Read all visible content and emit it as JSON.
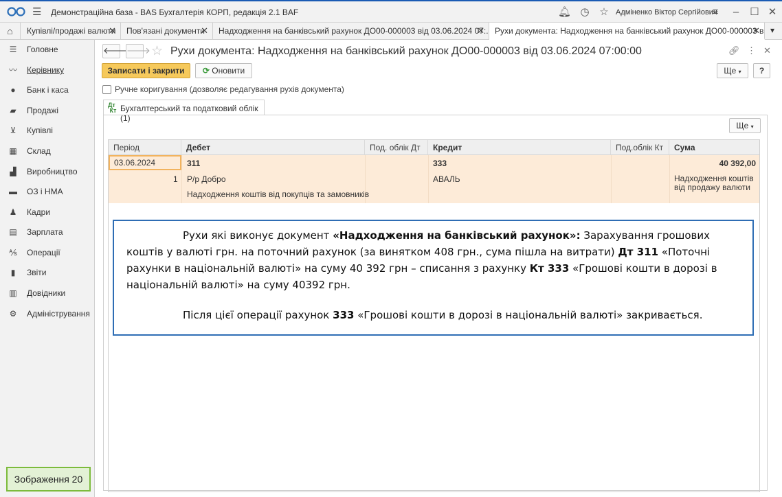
{
  "titlebar": {
    "app_title": "Демонстраційна база - BAS Бухгалтерія КОРП, редакція 2.1 BAF",
    "user": "Адміненко Віктор Сергійович"
  },
  "tabs": [
    {
      "label": "Купівлі/продажі валюти"
    },
    {
      "label": "Пов'язані документи"
    },
    {
      "label": "Надходження на банківський рахунок ДО00-000003 від 03.06.2024 07:..."
    },
    {
      "label": "Рухи документа: Надходження на банківський рахунок ДО00-000003 в..."
    }
  ],
  "sidebar": {
    "items": [
      {
        "label": "Головне",
        "icon": "menu-lines-icon"
      },
      {
        "label": "Керівнику",
        "icon": "trend-icon"
      },
      {
        "label": "Банк і каса",
        "icon": "coin-icon"
      },
      {
        "label": "Продажі",
        "icon": "bag-icon"
      },
      {
        "label": "Купівлі",
        "icon": "cart-icon"
      },
      {
        "label": "Склад",
        "icon": "grid-icon"
      },
      {
        "label": "Виробництво",
        "icon": "factory-icon"
      },
      {
        "label": "ОЗ і НМА",
        "icon": "truck-icon"
      },
      {
        "label": "Кадри",
        "icon": "person-icon"
      },
      {
        "label": "Зарплата",
        "icon": "money-icon"
      },
      {
        "label": "Операції",
        "icon": "operations-icon"
      },
      {
        "label": "Звіти",
        "icon": "bar-chart-icon"
      },
      {
        "label": "Довідники",
        "icon": "books-icon"
      },
      {
        "label": "Адміністрування",
        "icon": "gear-icon"
      }
    ],
    "image_caption": "Зображення 20"
  },
  "document": {
    "title": "Рухи документа: Надходження на банківський рахунок ДО00-000003 від 03.06.2024 07:00:00",
    "save_close": "Записати і закрити",
    "refresh": "Оновити",
    "more": "Ще",
    "help": "?",
    "manual_label": "Ручне коригування (дозволяє редагування рухів документа)",
    "subtab": "Бухгалтерський та податковий облік (1)",
    "subtab_icon": "Дт\nКт"
  },
  "table": {
    "headers": {
      "period": "Період",
      "debit": "Дебет",
      "tax_dt": "Под. облік Дт",
      "credit": "Кредит",
      "tax_kt": "Под.облік Кт",
      "sum": "Сума"
    },
    "row": {
      "period": "03.06.2024",
      "num": "1",
      "debit_account": "311",
      "debit_sub1": "Р/р Добро",
      "debit_sub2": "Надходження коштів від покупців та замовників",
      "credit_account": "333",
      "credit_sub1": "АВАЛЬ",
      "sum": "40 392,00",
      "sum_note_1": "Надходження коштів",
      "sum_note_2": "від продажу валюти"
    }
  },
  "annotation": {
    "p1_a": "Рухи які виконує документ ",
    "p1_b": "«Надходження на банківський рахунок»:",
    "p1_c": " Зарахування грошових коштів у валюті грн. на поточний рахунок (за винятком 408 грн., сума пішла на витрати) ",
    "p1_d": "Дт 311",
    "p1_e": " «Поточні рахунки в національній валюті» на суму 40 392 грн – списання з рахунку ",
    "p1_f": "Кт 333",
    "p1_g": " «Грошові кошти в дорозі в національній валюті» на суму 40392 грн.",
    "p2_a": "Після цієї операції рахунок ",
    "p2_b": "333",
    "p2_c": " «Грошові кошти в дорозі в національній валюті» закривається."
  }
}
